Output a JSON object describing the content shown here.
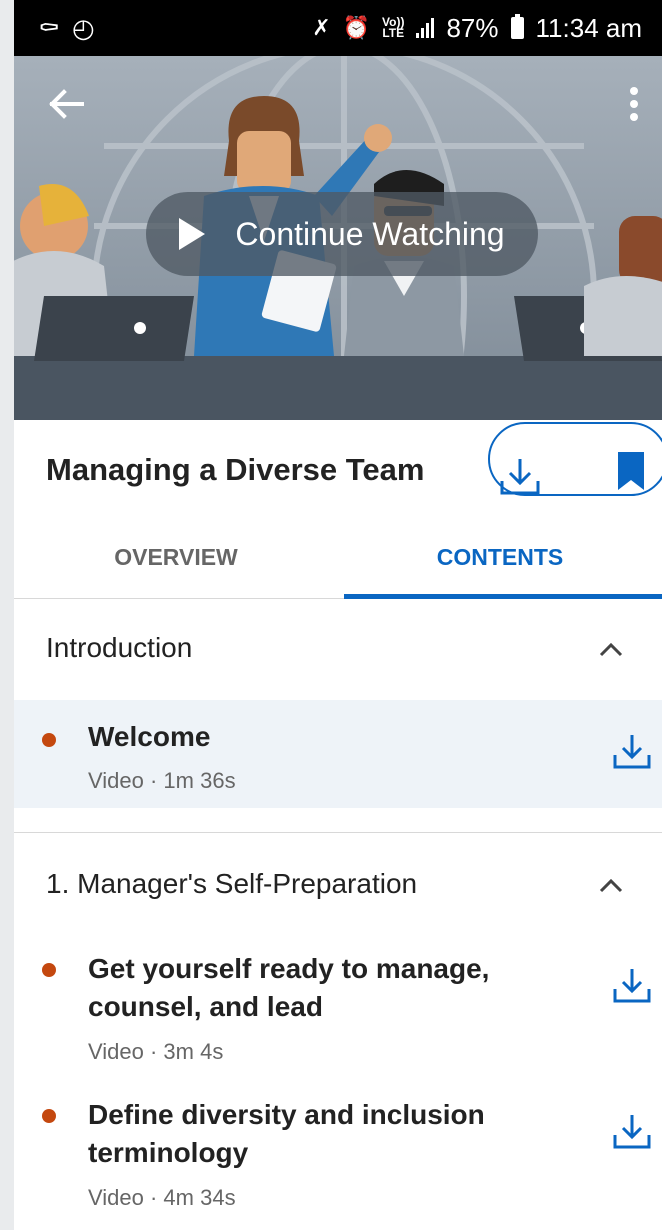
{
  "status_bar": {
    "battery": "87%",
    "time": "11:34 am",
    "volte_top": "Vo))",
    "volte_bottom": "LTE"
  },
  "hero": {
    "continue_label": "Continue Watching"
  },
  "course": {
    "title": "Managing a Diverse Team"
  },
  "tabs": [
    {
      "label": "OVERVIEW",
      "active": false
    },
    {
      "label": "CONTENTS",
      "active": true
    }
  ],
  "sections": [
    {
      "title": "Introduction",
      "items": [
        {
          "title": "Welcome",
          "meta": "Video · 1m 36s"
        }
      ]
    },
    {
      "title": "1. Manager's Self-Preparation",
      "items": [
        {
          "title": "Get yourself ready to manage, counsel, and lead",
          "meta": "Video · 3m 4s"
        },
        {
          "title": "Define diversity and inclusion terminology",
          "meta": "Video · 4m 34s"
        }
      ]
    }
  ],
  "colors": {
    "accent": "#0a66c2",
    "progress_dot": "#c4480f",
    "highlight_row": "#eef3f8"
  },
  "icons": [
    "back-arrow-icon",
    "more-vert-icon",
    "play-icon",
    "download-icon",
    "bookmark-icon",
    "chevron-up-icon"
  ]
}
